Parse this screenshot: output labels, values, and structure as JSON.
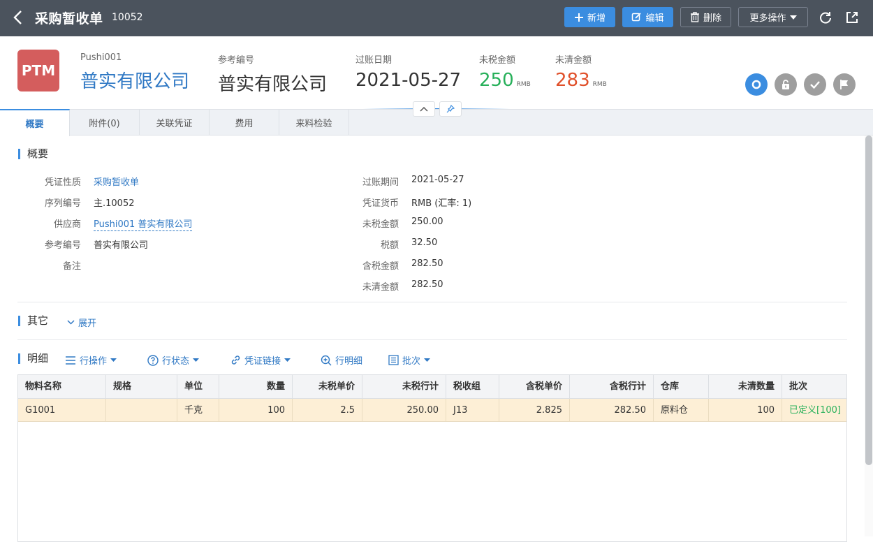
{
  "topbar": {
    "title": "采购暂收单",
    "doc_no": "10052",
    "buttons": {
      "add": "新增",
      "edit": "编辑",
      "delete": "删除",
      "more": "更多操作"
    }
  },
  "header": {
    "logo": "PTM",
    "fields": [
      {
        "label": "Pushi001",
        "value": "普实有限公司"
      },
      {
        "label": "参考编号",
        "value": "普实有限公司"
      },
      {
        "label": "过账日期",
        "value": "2021-05-27"
      },
      {
        "label": "未税金额",
        "value": "250",
        "unit": "RMB"
      },
      {
        "label": "未清金额",
        "value": "283",
        "unit": "RMB"
      }
    ]
  },
  "tabs": [
    "概要",
    "附件(0)",
    "关联凭证",
    "费用",
    "来料检验"
  ],
  "overview": {
    "title": "概要",
    "left": [
      {
        "label": "凭证性质",
        "value": "采购暂收单"
      },
      {
        "label": "序列编号",
        "value": "主.10052"
      },
      {
        "label": "供应商",
        "value": "Pushi001 普实有限公司"
      },
      {
        "label": "参考编号",
        "value": "普实有限公司"
      },
      {
        "label": "备注",
        "value": ""
      }
    ],
    "right": [
      {
        "label": "过账期间",
        "value": "2021-05-27"
      },
      {
        "label": "凭证货币",
        "value": "RMB (汇率: 1)"
      },
      {
        "label": "未税金额",
        "value": "250.00"
      },
      {
        "label": "税额",
        "value": "32.50"
      },
      {
        "label": "含税金额",
        "value": "282.50"
      },
      {
        "label": "未清金额",
        "value": "282.50"
      }
    ]
  },
  "other": {
    "title": "其它",
    "expand": "展开"
  },
  "detail": {
    "title": "明细",
    "toolbar": [
      "行操作",
      "行状态",
      "凭证链接",
      "行明细",
      "批次"
    ],
    "columns": [
      "物料名称",
      "规格",
      "单位",
      "数量",
      "未税单价",
      "未税行计",
      "税收组",
      "含税单价",
      "含税行计",
      "仓库",
      "未清数量",
      "批次"
    ],
    "rows": [
      [
        "G1001",
        "",
        "千克",
        "100",
        "2.5",
        "250.00",
        "J13",
        "2.825",
        "282.50",
        "原料仓",
        "100",
        "已定义[100]"
      ]
    ]
  },
  "colors": {
    "accent": "#3b8de0",
    "topbar": "#4b535d",
    "green": "#27b05a",
    "red": "#e0502a",
    "logo": "#d45d5d"
  }
}
